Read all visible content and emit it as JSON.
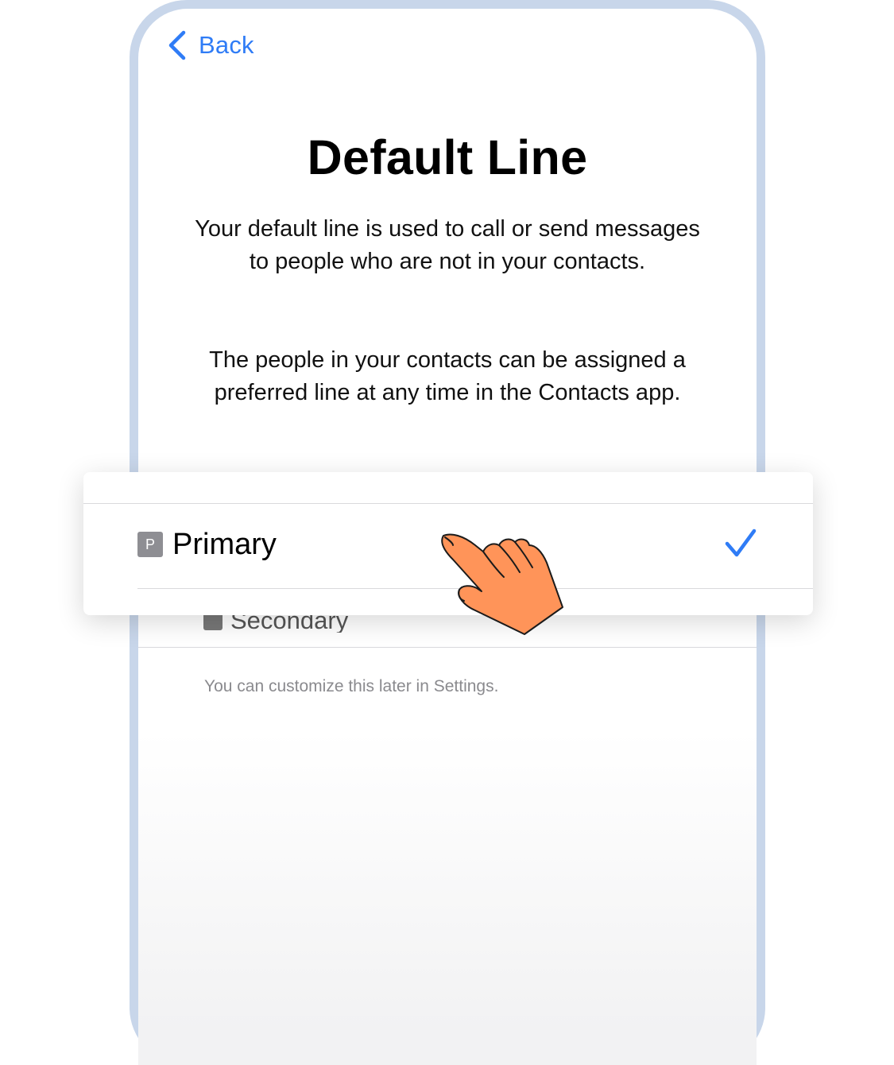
{
  "nav": {
    "back_label": "Back"
  },
  "page": {
    "title": "Default Line",
    "paragraph1": "Your default line is used to call or send messages to people who are not in your contacts.",
    "paragraph2": "The people in your contacts can be assigned a preferred line at any time in the Contacts app."
  },
  "lines": {
    "primary": {
      "badge": "P",
      "label": "Primary",
      "selected": true
    },
    "secondary": {
      "badge": "S",
      "label": "Secondary",
      "selected": false
    }
  },
  "footnote": "You can customize this later in Settings.",
  "colors": {
    "accent": "#2f7cf6",
    "hand": "#ff9459",
    "phone_frame": "#c8d6ea"
  }
}
